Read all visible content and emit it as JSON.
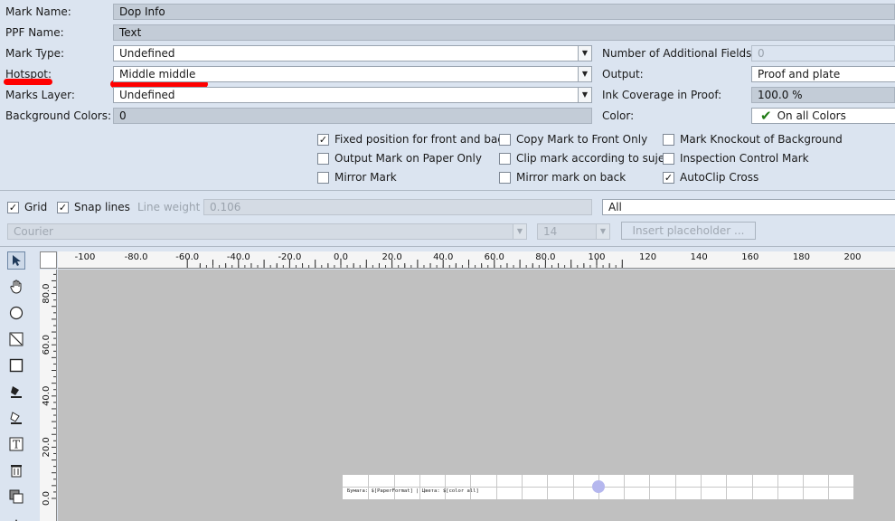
{
  "form": {
    "mark_name": {
      "label": "Mark Name:",
      "value": "Dop Info"
    },
    "ppf_name": {
      "label": "PPF Name:",
      "value": "Text"
    },
    "mark_type": {
      "label": "Mark Type:",
      "value": "Undefined"
    },
    "hotspot": {
      "label": "Hotspot:",
      "value": "Middle middle"
    },
    "marks_layer": {
      "label": "Marks Layer:",
      "value": "Undefined"
    },
    "background_colors": {
      "label": "Background Colors:",
      "value": "0"
    },
    "additional_fields": {
      "label": "Number of Additional Fields:",
      "value": "0"
    },
    "output": {
      "label": "Output:",
      "value": "Proof and plate"
    },
    "ink_coverage": {
      "label": "Ink Coverage in Proof:",
      "value": "100.0 %"
    },
    "color": {
      "label": "Color:",
      "value": "On all Colors"
    }
  },
  "options": [
    {
      "label": "Fixed position for front and back",
      "checked": true
    },
    {
      "label": "Output Mark on Paper Only",
      "checked": false
    },
    {
      "label": "Mirror Mark",
      "checked": false
    },
    {
      "label": "Copy Mark to Front Only",
      "checked": false
    },
    {
      "label": "Clip mark according to sujet",
      "checked": false
    },
    {
      "label": "Mirror mark on back",
      "checked": false
    },
    {
      "label": "Mark Knockout of Background",
      "checked": false
    },
    {
      "label": "Inspection Control Mark",
      "checked": false
    },
    {
      "label": "AutoClip Cross",
      "checked": true
    }
  ],
  "toolbar": {
    "grid_label": "Grid",
    "grid_checked": true,
    "snap_label": "Snap lines",
    "snap_checked": true,
    "line_weight_label": "Line weight",
    "line_weight_value": "0.106",
    "layer_filter": "All",
    "font": "Courier",
    "font_size": "14",
    "insert_placeholder": "Insert placeholder ..."
  },
  "ruler": {
    "h_labels": [
      "-100",
      "-80.0",
      "-60.0",
      "-40.0",
      "-20.0",
      "0.0",
      "20.0",
      "40.0",
      "60.0",
      "80.0",
      "100",
      "120",
      "140",
      "160",
      "180",
      "200"
    ],
    "v_labels": [
      "80.0",
      "60.0",
      "40.0",
      "20.0",
      "0.0"
    ]
  },
  "canvas": {
    "mark_text": "Бумага: $[PaperFormat]  |  Цвета: $[color all]"
  },
  "tools": [
    "pointer-icon",
    "hand-icon",
    "ellipse-icon",
    "line-icon",
    "rectangle-icon",
    "fill-icon",
    "eraser-icon",
    "text-icon",
    "trash-icon",
    "copy-icon",
    "more-icon"
  ],
  "colors": {
    "accent_mark": "#ff0000",
    "canvas_bg": "#c0c0c0",
    "hotspot": "#b5b7ee"
  }
}
